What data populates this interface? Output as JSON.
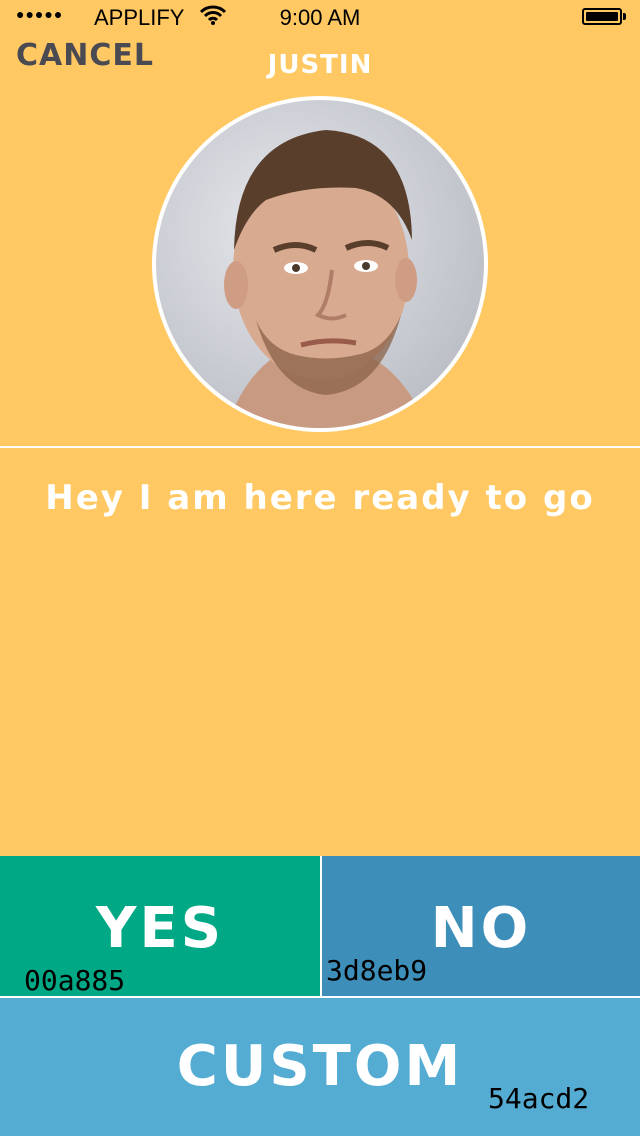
{
  "status_bar": {
    "signal": "●●●●●",
    "carrier": "APPLIFY",
    "time": "9:00 AM"
  },
  "header": {
    "cancel_label": "CANCEL",
    "contact_name": "JUSTIN"
  },
  "message": "Hey I am here ready to go",
  "actions": {
    "yes": {
      "label": "YES",
      "color_hex": "00a885"
    },
    "no": {
      "label": "NO",
      "color_hex": "3d8eb9"
    },
    "custom": {
      "label": "CUSTOM",
      "color_hex": "54acd2"
    }
  },
  "colors": {
    "background": "#ffc862",
    "yes": "#00a885",
    "no": "#3d8eb9",
    "custom": "#54acd2",
    "cancel_text": "#4a4a52"
  }
}
